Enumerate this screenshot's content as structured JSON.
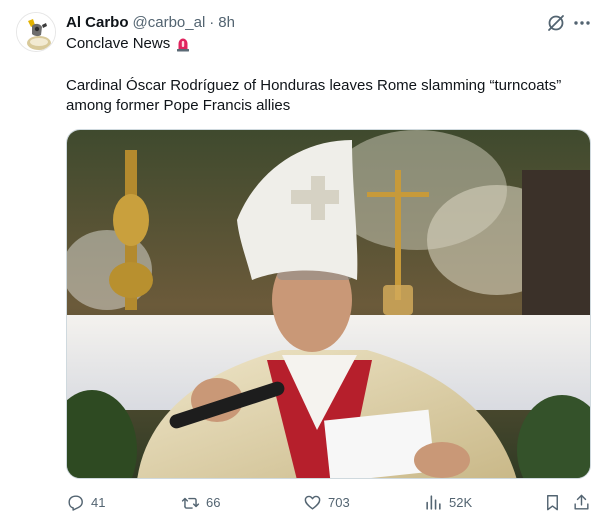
{
  "author": {
    "display_name": "Al Carbo",
    "handle": "@carbo_al",
    "separator": "·",
    "time": "8h",
    "avatar_icon": "avatar-image"
  },
  "context": {
    "text": "Conclave News",
    "emoji_icon": "rotating-light-icon"
  },
  "tweet": {
    "text": "Cardinal Óscar Rodríguez of Honduras leaves Rome slamming “turncoats” among former Pope Francis allies"
  },
  "media": {
    "icon": "photo-cardinal-speaking"
  },
  "header_icons": [
    "grok-icon",
    "more-icon"
  ],
  "actions": {
    "replies": "41",
    "reposts": "66",
    "likes": "703",
    "views": "52K",
    "bookmark_icon": "bookmark-icon",
    "share_icon": "share-icon"
  },
  "colors": {
    "text_primary": "#0f1419",
    "text_secondary": "#536471",
    "border": "#cfd9de"
  }
}
